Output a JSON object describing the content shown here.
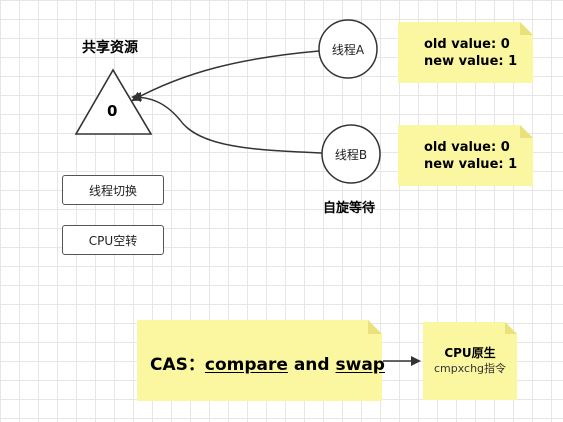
{
  "shared_resource": {
    "title": "共享资源",
    "value": "0"
  },
  "threads": {
    "a": {
      "label": "线程A",
      "old_value": "old value: 0",
      "new_value": "new value: 1"
    },
    "b": {
      "label": "线程B",
      "old_value": "old value: 0",
      "new_value": "new value: 1",
      "caption": "自旋等待"
    }
  },
  "boxes": {
    "thread_switch": "线程切换",
    "cpu_spin": "CPU空转"
  },
  "cas": {
    "prefix": "CAS：",
    "compare": "compare",
    "and": " and ",
    "swap": "swap"
  },
  "cpu_native": {
    "title": "CPU原生",
    "instruction": "cmpxchg指令"
  },
  "colors": {
    "note": "#fbf7a0",
    "note_fold": "#e9e27c",
    "stroke": "#333333"
  }
}
